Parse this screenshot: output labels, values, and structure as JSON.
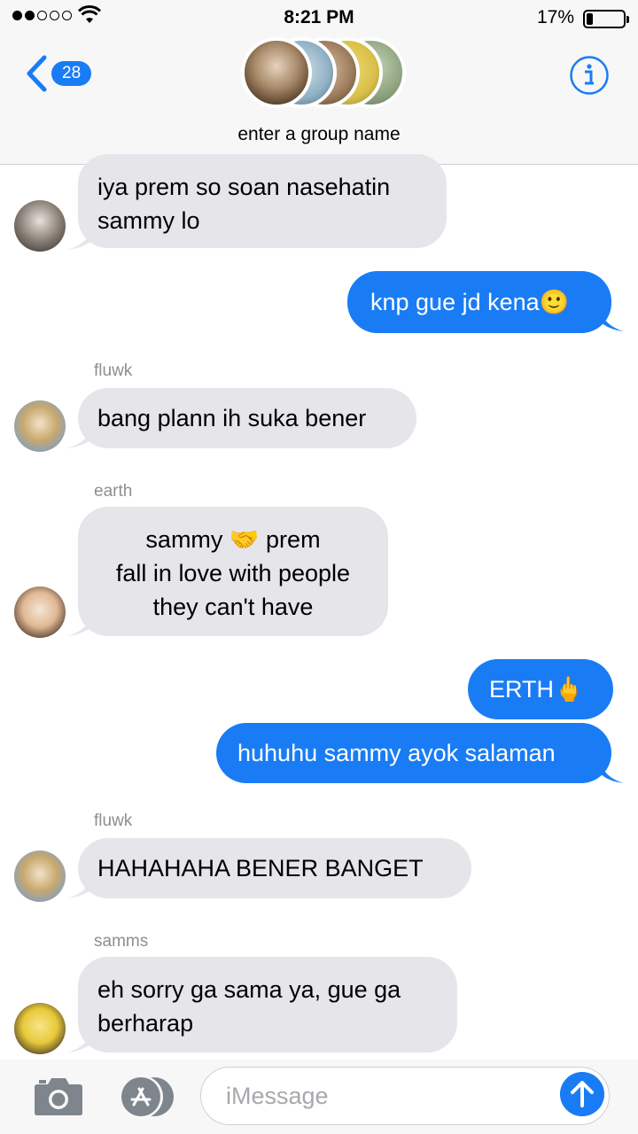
{
  "status_bar": {
    "time": "8:21 PM",
    "battery_text": "17%",
    "battery_level": 0.17,
    "signal_bars_filled": 2,
    "signal_bars_total": 5
  },
  "header": {
    "back_badge": "28",
    "group_name_placeholder": "enter a group name"
  },
  "messages": [
    {
      "direction": "in",
      "sender": "",
      "lines": [
        "iya prem so soan nasehatin",
        "sammy lo"
      ]
    },
    {
      "direction": "out",
      "lines": [
        "knp gue jd kena🙂"
      ]
    },
    {
      "direction": "in",
      "sender": "fluwk",
      "lines": [
        "bang plann ih suka bener"
      ]
    },
    {
      "direction": "in",
      "sender": "earth",
      "lines": [
        "sammy 🤝  prem",
        "fall in love with people",
        "they can't have"
      ]
    },
    {
      "direction": "out",
      "lines": [
        "ERTH🖕"
      ]
    },
    {
      "direction": "out",
      "lines": [
        "huhuhu sammy ayok salaman"
      ]
    },
    {
      "direction": "in",
      "sender": "fluwk",
      "lines": [
        "HAHAHAHA BENER BANGET"
      ]
    },
    {
      "direction": "in",
      "sender": "samms",
      "lines": [
        "eh sorry ga sama ya, gue ga",
        "berharap"
      ]
    }
  ],
  "input": {
    "placeholder": "iMessage"
  },
  "colors": {
    "accent": "#1a7cf5",
    "incoming_bubble": "#e5e5ea",
    "outgoing_bubble": "#1a7cf5"
  },
  "icons": [
    "wifi-icon",
    "back-chevron-icon",
    "info-icon",
    "camera-icon",
    "app-store-icon",
    "send-arrow-icon"
  ]
}
